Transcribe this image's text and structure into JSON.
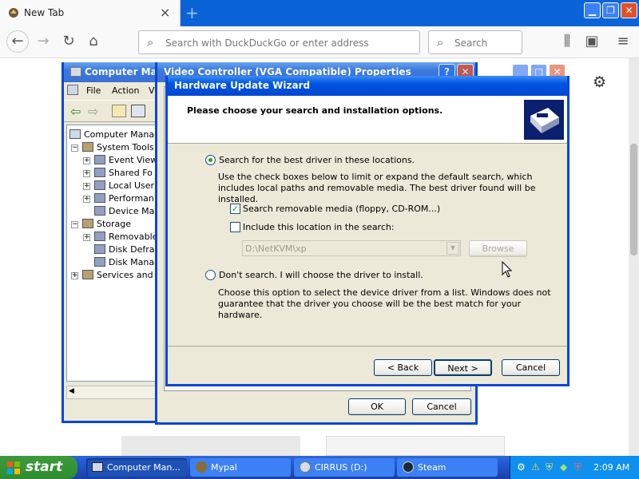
{
  "browser": {
    "tab_title": "New Tab",
    "address_placeholder": "Search with DuckDuckGo or enter address",
    "search_placeholder": "Search"
  },
  "computer_management": {
    "title": "Computer Mana",
    "menu": [
      "File",
      "Action",
      "Vie"
    ],
    "tree": [
      {
        "label": "Computer Manage",
        "level": 0
      },
      {
        "label": "System Tools",
        "level": 1
      },
      {
        "label": "Event View",
        "level": 2
      },
      {
        "label": "Shared Fo",
        "level": 2
      },
      {
        "label": "Local User",
        "level": 2
      },
      {
        "label": "Performan",
        "level": 2
      },
      {
        "label": "Device Ma",
        "level": 2
      },
      {
        "label": "Storage",
        "level": 1
      },
      {
        "label": "Removable",
        "level": 2
      },
      {
        "label": "Disk Defra",
        "level": 2
      },
      {
        "label": "Disk Manag",
        "level": 2
      },
      {
        "label": "Services and A",
        "level": 1
      }
    ]
  },
  "properties_dialog": {
    "title": "Video Controller (VGA Compatible) Properties",
    "ok_label": "OK",
    "cancel_label": "Cancel"
  },
  "wizard": {
    "title": "Hardware Update Wizard",
    "heading": "Please choose your search and installation options.",
    "option_search_label": "Search for the best driver in these locations.",
    "option_search_desc": "Use the check boxes below to limit or expand the default search, which includes local paths and removable media. The best driver found will be installed.",
    "check_removable_label": "Search removable media (floppy, CD-ROM...)",
    "check_location_label": "Include this location in the search:",
    "location_value": "D:\\NetKVM\\xp",
    "browse_label": "Browse",
    "option_dont_search_label": "Don't search. I will choose the driver to install.",
    "option_dont_search_desc": "Choose this option to select the device driver from a list.  Windows does not guarantee that the driver you choose will be the best match for your hardware.",
    "back_label": "< Back",
    "next_label": "Next >",
    "cancel_label": "Cancel",
    "search_option_selected": true,
    "removable_checked": true,
    "location_checked": false
  },
  "taskbar": {
    "start_label": "start",
    "items": [
      {
        "label": "Computer Man...",
        "icon": "computer-management-icon",
        "active": true
      },
      {
        "label": "Mypal",
        "icon": "mypal-icon",
        "active": false
      },
      {
        "label": "CIRRUS (D:)",
        "icon": "cd-drive-icon",
        "active": false
      },
      {
        "label": "Steam",
        "icon": "steam-icon",
        "active": false
      }
    ],
    "clock": "2:09 AM"
  }
}
